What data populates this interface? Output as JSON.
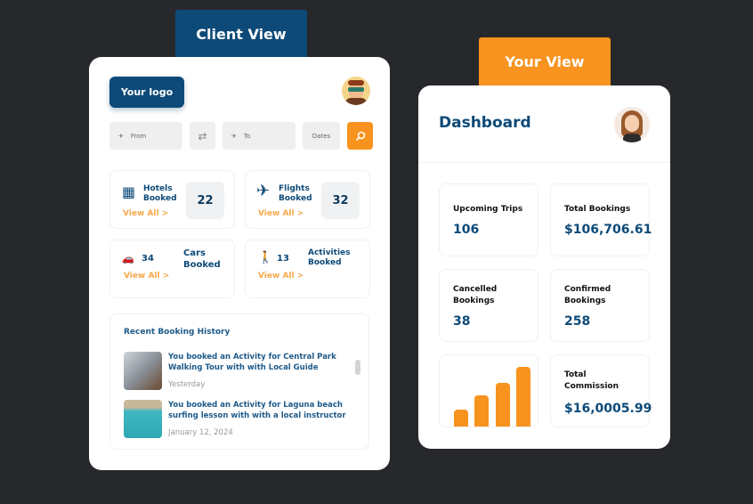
{
  "client": {
    "tab": "Client View",
    "logo": "Your logo",
    "search": {
      "from": "From",
      "to": "To",
      "dates": "Dates"
    },
    "stats": [
      {
        "label1": "Hotels",
        "label2": "Booked",
        "value": "22",
        "link": "View All >",
        "icon": "hotel-building-icon"
      },
      {
        "label1": "Flights",
        "label2": "Booked",
        "value": "32",
        "link": "View All >",
        "icon": "airplane-icon"
      },
      {
        "label1": "Cars",
        "label2": "Booked",
        "value": "34",
        "link": "View All >",
        "icon": "car-icon"
      },
      {
        "label1": "Activities",
        "label2": "Booked",
        "value": "13",
        "link": "View All >",
        "icon": "hiker-icon"
      }
    ],
    "history": {
      "title": "Recent Booking History",
      "items": [
        {
          "text": "You booked an Activity for Central Park Walking Tour with with Local Guide",
          "date": "Yesterday"
        },
        {
          "text": "You booked an Activity for Laguna beach surfing lesson with with a local instructor",
          "date": "January 12, 2024"
        }
      ]
    }
  },
  "your": {
    "tab": "Your View",
    "title": "Dashboard",
    "tiles": [
      {
        "label": "Upcoming Trips",
        "value": "106"
      },
      {
        "label": "Total Bookings",
        "value": "$106,706.61"
      },
      {
        "label": "Cancelled Bookings",
        "value": "38"
      },
      {
        "label": "Confirmed Bookings",
        "value": "258"
      },
      {
        "label": "Total Commission",
        "value": "$16,0005.99"
      }
    ],
    "bars_percent": [
      29,
      52,
      73,
      100
    ]
  },
  "colors": {
    "brand": "#0d4a78",
    "accent": "#f7931e",
    "background": "#27282c"
  }
}
